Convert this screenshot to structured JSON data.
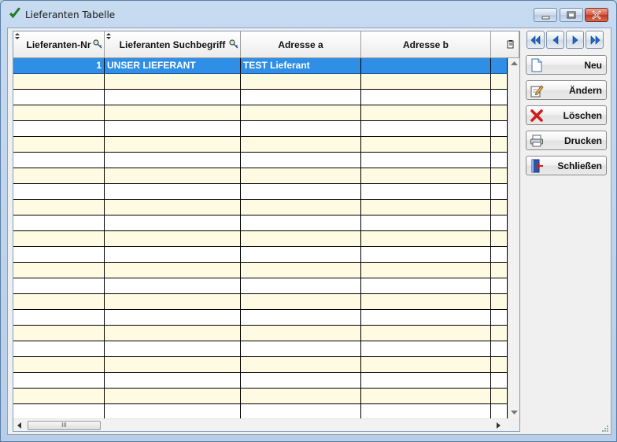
{
  "window": {
    "title": "Lieferanten Tabelle",
    "accent_color": "#2f8fe6",
    "row_alt_color": "#fffbe2"
  },
  "grid": {
    "columns": [
      {
        "label": "Lieferanten-Nr",
        "sortable": true,
        "searchable": true
      },
      {
        "label": "Lieferanten Suchbegriff",
        "sortable": true,
        "searchable": true
      },
      {
        "label": "Adresse a",
        "sortable": false,
        "searchable": false
      },
      {
        "label": "Adresse b",
        "sortable": false,
        "searchable": false
      }
    ],
    "rows": [
      {
        "nr": "1",
        "suchbegriff": "UNSER LIEFERANT",
        "adresse_a": "TEST Lieferant",
        "adresse_b": "",
        "selected": true
      }
    ],
    "hscroll_thumb_label": "III"
  },
  "navigation": {
    "first_icon": "double-chevron-left-icon",
    "prev_icon": "chevron-left-icon",
    "next_icon": "chevron-right-icon",
    "last_icon": "double-chevron-right-icon"
  },
  "actions": {
    "new_label": "Neu",
    "edit_label": "Ändern",
    "delete_label": "Löschen",
    "print_label": "Drucken",
    "close_label": "Schließen"
  }
}
